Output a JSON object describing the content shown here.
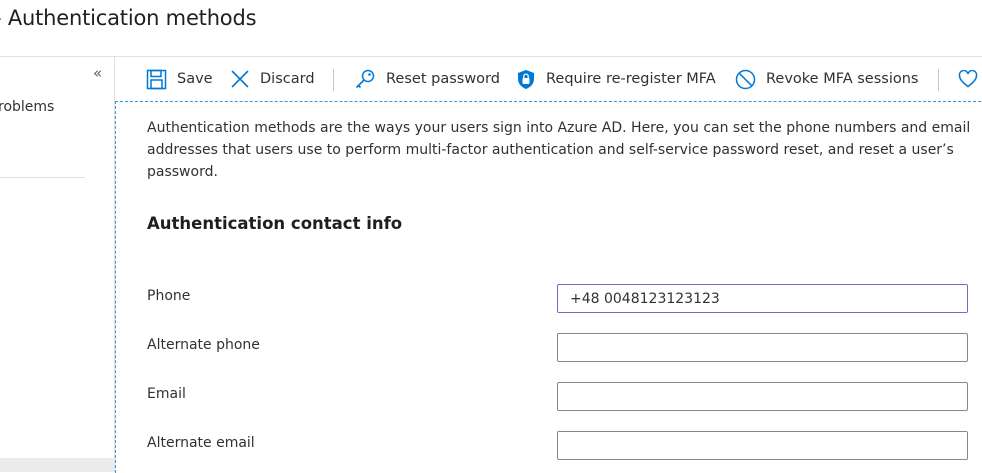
{
  "page": {
    "title": "- Authentication methods"
  },
  "left_nav": {
    "collapse_glyph": "«",
    "item_partial_label": "roblems"
  },
  "toolbar": {
    "save_label": "Save",
    "discard_label": "Discard",
    "reset_password_label": "Reset password",
    "require_reregister_label": "Require re-register MFA",
    "revoke_sessions_label": "Revoke MFA sessions"
  },
  "content": {
    "description": "Authentication methods are the ways your users sign into Azure AD. Here, you can set the phone numbers and email addresses that users use to perform multi-factor authentication and self-service password reset, and reset a user’s password.",
    "section_title": "Authentication contact info",
    "fields": [
      {
        "label": "Phone",
        "value": "+48 0048123123123"
      },
      {
        "label": "Alternate phone",
        "value": ""
      },
      {
        "label": "Email",
        "value": ""
      },
      {
        "label": "Alternate email",
        "value": ""
      }
    ]
  },
  "colors": {
    "accent_blue": "#0078d4",
    "focus_border": "#8661c5",
    "dashed_border": "#3a96dd"
  }
}
